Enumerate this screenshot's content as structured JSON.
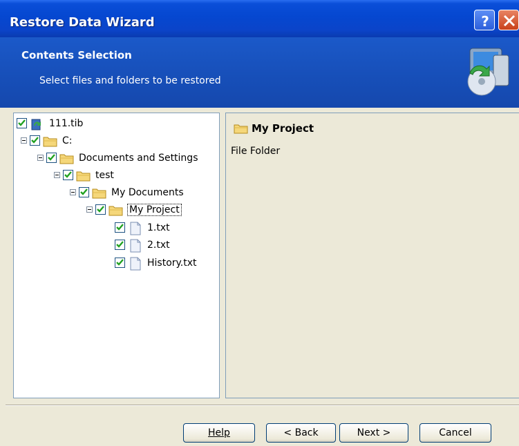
{
  "window": {
    "title": "Restore Data Wizard"
  },
  "banner": {
    "title": "Contents Selection",
    "subtitle": "Select files and folders to be restored"
  },
  "tree": [
    {
      "label": "111.tib",
      "checked": true,
      "icon": "archive-icon"
    },
    {
      "label": "C:",
      "checked": true,
      "icon": "folder-icon"
    },
    {
      "label": "Documents and Settings",
      "checked": true,
      "icon": "folder-icon"
    },
    {
      "label": "test",
      "checked": true,
      "icon": "folder-icon"
    },
    {
      "label": "My Documents",
      "checked": true,
      "icon": "folder-icon"
    },
    {
      "label": "My Project",
      "checked": true,
      "icon": "folder-icon",
      "selected": true
    },
    {
      "label": "1.txt",
      "checked": true,
      "icon": "file-icon"
    },
    {
      "label": "2.txt",
      "checked": true,
      "icon": "file-icon"
    },
    {
      "label": "History.txt",
      "checked": true,
      "icon": "file-icon"
    }
  ],
  "details": {
    "name": "My Project",
    "type": "File Folder"
  },
  "buttons": {
    "help": "Help",
    "back": "< Back",
    "next": "Next >",
    "cancel": "Cancel"
  },
  "colors": {
    "titlebar": "#0a4ed8",
    "banner": "#1b59c9",
    "face": "#ece9d8",
    "check": "#21a121"
  }
}
